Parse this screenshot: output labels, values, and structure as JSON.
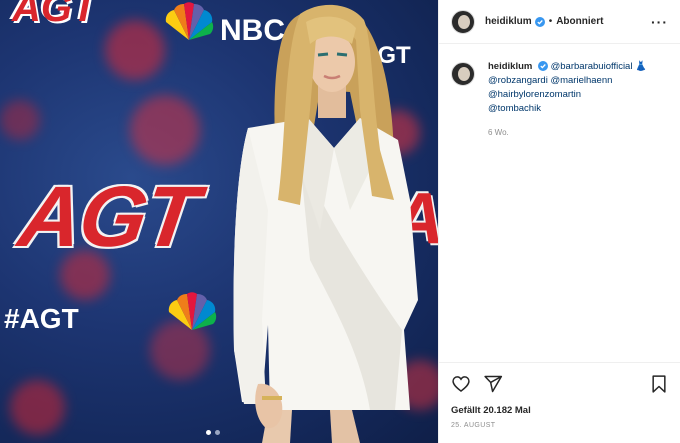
{
  "photo": {
    "agt_logo_text": "AGT",
    "hashtag_text": "#AGT",
    "nbc_text": "NBC",
    "carousel": {
      "count": 2,
      "active_index": 0
    }
  },
  "post": {
    "header": {
      "username": "heidiklum",
      "separator": "•",
      "follow_status": "Abonniert",
      "more_label": "···"
    },
    "caption": {
      "username": "heidiklum",
      "mention_1": "@barbarabuiofficial",
      "emoji": "👗",
      "mention_2": "@robzangardi",
      "mention_3": "@marielhaenn",
      "mention_4": "@hairbylorenzomartin",
      "mention_5": "@tombachik",
      "time_ago": "6 Wo."
    },
    "likes_text": "Gefällt 20.182 Mal",
    "date_text": "25. AUGUST"
  },
  "colors": {
    "verified_blue": "#3897f0",
    "mention_blue": "#00376b",
    "agt_red": "#d9262c",
    "background_navy": "#1d3572"
  },
  "icons": [
    "verified-badge-icon",
    "more-options-icon",
    "heart-icon",
    "share-icon",
    "bookmark-icon"
  ]
}
